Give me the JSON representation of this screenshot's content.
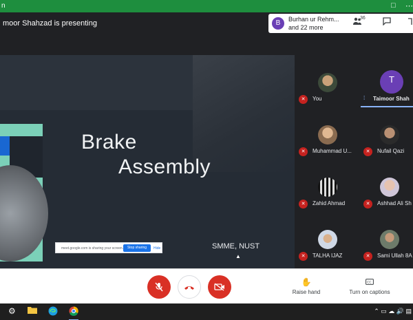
{
  "sharebar": {
    "text": "n",
    "controls": [
      "–",
      "□",
      "⋯"
    ]
  },
  "header": {
    "presenting": "moor Shahzad is presenting"
  },
  "notification": {
    "avatar_letter": "B",
    "line1": "Burhan ur Rehm...",
    "line2": "and 22 more"
  },
  "toolbar": {
    "participants_count": "36",
    "people_icon": "people-icon",
    "chat_icon": "chat-icon",
    "activities_icon": "activities-icon"
  },
  "slide": {
    "title_line1": "Brake",
    "title_line2": "Assembly",
    "subtitle": "SMME, NUST",
    "share_banner": {
      "text": "meet.google.com is sharing your screen.",
      "stop_label": "Stop sharing",
      "hide_label": "Hide"
    }
  },
  "participants": [
    {
      "name": "You",
      "avatar": "photo1",
      "muted": true
    },
    {
      "name": "Taimoor Shah",
      "avatar": "letter",
      "letter": "T",
      "muted": false,
      "speaking": true
    },
    {
      "name": "Muhammad U...",
      "avatar": "photo2",
      "muted": true
    },
    {
      "name": "Nufail Qazi",
      "avatar": "photo3",
      "muted": true
    },
    {
      "name": "Zahid Ahmad",
      "avatar": "photo4",
      "muted": true
    },
    {
      "name": "Ashhad Ali Sh",
      "avatar": "photo5",
      "muted": true
    },
    {
      "name": "TALHA IJAZ",
      "avatar": "photo6",
      "muted": true
    },
    {
      "name": "Sami Ullah 8A",
      "avatar": "photo7",
      "muted": true
    }
  ],
  "controls": {
    "mic_icon": "mic-off-icon",
    "end_call_icon": "hangup-icon",
    "camera_icon": "camera-off-icon",
    "raise_hand": "Raise hand",
    "captions": "Turn on captions"
  },
  "taskbar": {
    "items": [
      "settings-icon",
      "file-explorer-icon",
      "edge-icon",
      "chrome-icon"
    ]
  },
  "colors": {
    "accent_green": "#1e8e3e",
    "danger_red": "#d93025",
    "purple": "#6a3fb5",
    "link_blue": "#8ab4f8"
  }
}
